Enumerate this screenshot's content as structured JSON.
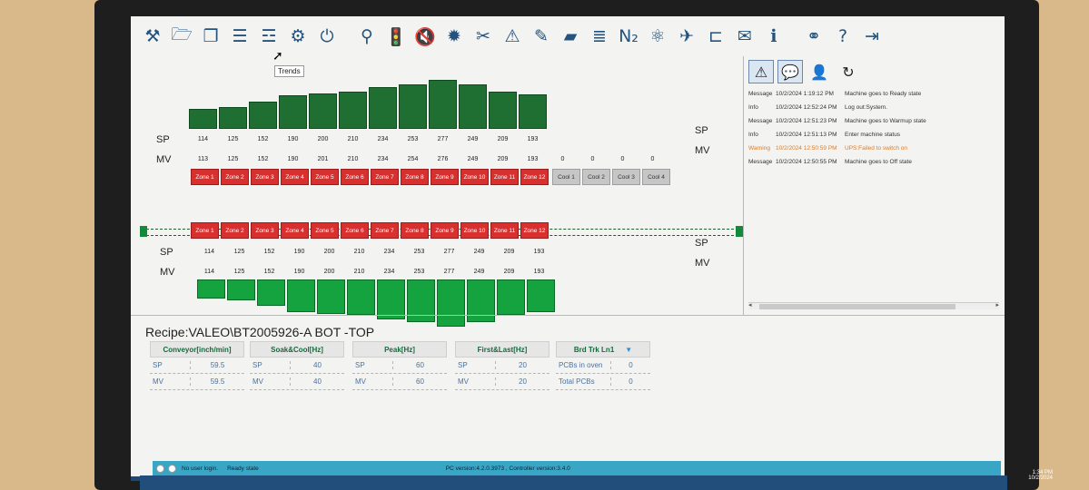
{
  "toolbar": {
    "icons": [
      "tools-icon",
      "folder-icon",
      "copy-icon",
      "list-icon",
      "trends-icon",
      "gear-icon",
      "power-icon",
      "valve-icon",
      "traffic-light-icon",
      "mute-icon",
      "sprocket-icon",
      "wrench-icon",
      "warning-icon",
      "pen-icon",
      "eraser-icon",
      "database-icon",
      "n2-icon",
      "fan-icon",
      "nozzle-icon",
      "rail-icon",
      "mail-icon",
      "info-icon",
      "link-icon",
      "help-icon",
      "logout-icon"
    ],
    "glyphs": [
      "⚒",
      "🗁",
      "❐",
      "☰",
      "☲",
      "⚙",
      "⏻",
      "⚲",
      "🚦",
      "🔇",
      "✹",
      "✂",
      "⚠",
      "✎",
      "▰",
      "≣",
      "N₂",
      "⚛",
      "✈",
      "⊏",
      "✉",
      "ℹ",
      "⚭",
      "?",
      "⇥"
    ],
    "tooltip": "Trends"
  },
  "top": {
    "sp_label": "SP",
    "mv_label": "MV",
    "sp_right": "SP",
    "mv_right": "MV",
    "sp": [
      "114",
      "125",
      "152",
      "190",
      "200",
      "210",
      "234",
      "253",
      "277",
      "249",
      "209",
      "193"
    ],
    "mv": [
      "113",
      "125",
      "152",
      "190",
      "201",
      "210",
      "234",
      "254",
      "276",
      "249",
      "209",
      "193",
      "0",
      "0",
      "0",
      "0"
    ],
    "bar_levels": [
      114,
      125,
      152,
      190,
      200,
      210,
      234,
      253,
      277,
      249,
      209,
      193
    ],
    "zones": [
      "Zone 1",
      "Zone 2",
      "Zone 3",
      "Zone 4",
      "Zone 5",
      "Zone 6",
      "Zone 7",
      "Zone 8",
      "Zone 9",
      "Zone 10",
      "Zone 11",
      "Zone 12"
    ],
    "cools": [
      "Cool 1",
      "Cool 2",
      "Cool 3",
      "Cool 4"
    ]
  },
  "bottom": {
    "sp_label": "SP",
    "mv_label": "MV",
    "sp_right": "SP",
    "mv_right": "MV",
    "sp": [
      "114",
      "125",
      "152",
      "190",
      "200",
      "210",
      "234",
      "253",
      "277",
      "249",
      "209",
      "193"
    ],
    "mv": [
      "114",
      "125",
      "152",
      "190",
      "200",
      "210",
      "234",
      "253",
      "277",
      "249",
      "209",
      "193"
    ],
    "bar_levels": [
      114,
      125,
      152,
      190,
      200,
      210,
      234,
      253,
      277,
      249,
      209,
      193
    ],
    "zones": [
      "Zone 1",
      "Zone 2",
      "Zone 3",
      "Zone 4",
      "Zone 5",
      "Zone 6",
      "Zone 7",
      "Zone 8",
      "Zone 9",
      "Zone 10",
      "Zone 11",
      "Zone 12"
    ]
  },
  "log": {
    "icons": [
      "warning-icon",
      "message-icon",
      "user-icon",
      "refresh-icon"
    ],
    "glyphs": [
      "⚠",
      "💬",
      "👤",
      "↻"
    ],
    "entries": [
      {
        "type": "Message",
        "time": "10/2/2024 1:19:12 PM",
        "text": "Machine goes to Ready state"
      },
      {
        "type": "Info",
        "time": "10/2/2024 12:52:24 PM",
        "text": "Log out:System."
      },
      {
        "type": "Message",
        "time": "10/2/2024 12:51:23 PM",
        "text": "Machine goes to Warmup state"
      },
      {
        "type": "Info",
        "time": "10/2/2024 12:51:13 PM",
        "text": "Enter machine status"
      },
      {
        "type": "Warning",
        "time": "10/2/2024 12:50:59 PM",
        "text": "UPS:Failed to switch on"
      },
      {
        "type": "Message",
        "time": "10/2/2024 12:50:55 PM",
        "text": "Machine goes to Off state"
      }
    ]
  },
  "recipe": "Recipe:VALEO\\BT2005926-A BOT -TOP",
  "params": [
    {
      "header": "Conveyor[inch/min]",
      "rows": [
        [
          "SP",
          "59.5"
        ],
        [
          "MV",
          "59.5"
        ]
      ]
    },
    {
      "header": "Soak&Cool[Hz]",
      "rows": [
        [
          "SP",
          "40"
        ],
        [
          "MV",
          "40"
        ]
      ]
    },
    {
      "header": "Peak[Hz]",
      "rows": [
        [
          "SP",
          "60"
        ],
        [
          "MV",
          "60"
        ]
      ]
    },
    {
      "header": "First&Last[Hz]",
      "rows": [
        [
          "SP",
          "20"
        ],
        [
          "MV",
          "20"
        ]
      ]
    },
    {
      "header": "Brd Trk Ln1",
      "rows": [
        [
          "PCBs in oven",
          "0"
        ],
        [
          "Total PCBs",
          "0"
        ]
      ]
    }
  ],
  "status": {
    "login": "No user login.",
    "state": "Ready state",
    "version": "PC version:4.2.0.3973 , Controller version:3.4.0"
  },
  "tray": {
    "time": "1:34 PM",
    "date": "10/2/2024"
  }
}
